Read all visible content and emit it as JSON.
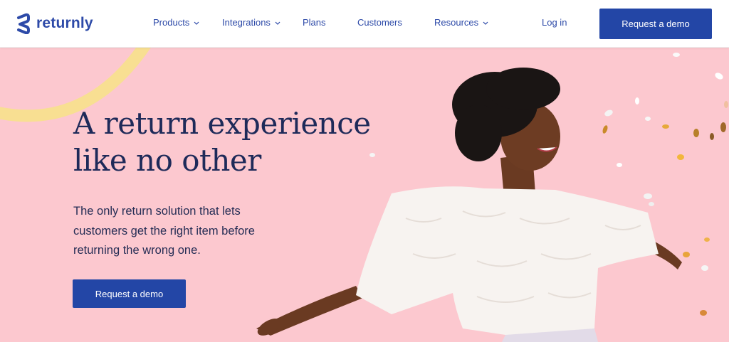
{
  "brand": {
    "name": "returnly"
  },
  "nav": {
    "items": [
      {
        "label": "Products",
        "has_dropdown": true
      },
      {
        "label": "Integrations",
        "has_dropdown": true
      },
      {
        "label": "Plans",
        "has_dropdown": false
      },
      {
        "label": "Customers",
        "has_dropdown": false
      },
      {
        "label": "Resources",
        "has_dropdown": true
      }
    ],
    "login_label": "Log in",
    "cta_label": "Request a demo"
  },
  "hero": {
    "title_line1": "A return experience",
    "title_line2": "like no other",
    "subtitle_line1": "The only return solution that lets",
    "subtitle_line2": "customers get the right item before",
    "subtitle_line3": "returning the wrong one.",
    "cta_label": "Request a demo"
  },
  "colors": {
    "brand_blue": "#2346a6",
    "hero_background": "#fcc8cf",
    "heading": "#1e2a59",
    "accent_arc": "#f8df92"
  },
  "icons": {
    "logo": "returnly-logo-mark",
    "dropdown": "chevron-down-icon"
  }
}
